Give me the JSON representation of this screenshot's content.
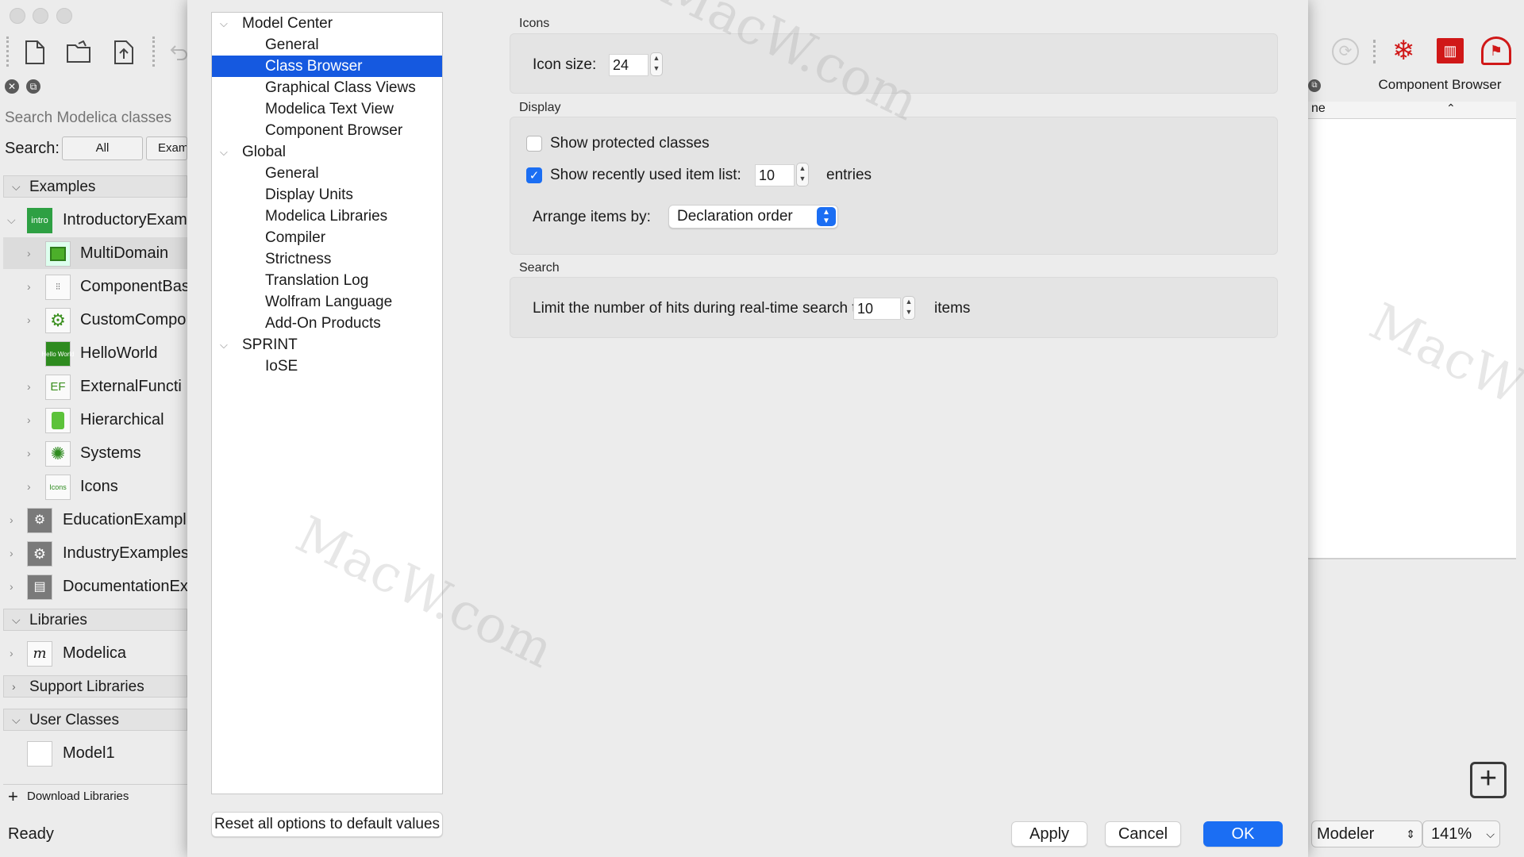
{
  "left_panel": {
    "search_placeholder": "Search Modelica classes",
    "search_label": "Search:",
    "search_scope": [
      "All",
      "Exam"
    ],
    "groups": {
      "examples": "Examples",
      "libraries": "Libraries",
      "support_libraries": "Support Libraries",
      "user_classes": "User Classes"
    },
    "tree": [
      {
        "label": "IntroductoryExam",
        "icon": "intro"
      },
      {
        "label": "MultiDomain"
      },
      {
        "label": "ComponentBas"
      },
      {
        "label": "CustomCompo"
      },
      {
        "label": "HelloWorld",
        "icon": "Hello World"
      },
      {
        "label": "ExternalFuncti",
        "icon": "EF"
      },
      {
        "label": "Hierarchical"
      },
      {
        "label": "Systems"
      },
      {
        "label": "Icons",
        "icon": "Icons"
      },
      {
        "label": "EducationExampl"
      },
      {
        "label": "IndustryExamples"
      },
      {
        "label": "DocumentationEx"
      },
      {
        "label": "Modelica"
      },
      {
        "label": "Model1"
      }
    ],
    "download_libraries": "Download Libraries",
    "status": "Ready"
  },
  "right_panel": {
    "title": "Component Browser",
    "column_header": "ne",
    "mode": "Modeler",
    "zoom": "141%"
  },
  "nav_tree": [
    {
      "label": "Model Center"
    },
    {
      "label": "General"
    },
    {
      "label": "Class Browser"
    },
    {
      "label": "Graphical Class Views"
    },
    {
      "label": "Modelica Text View"
    },
    {
      "label": "Component Browser"
    },
    {
      "label": "Global"
    },
    {
      "label": "General"
    },
    {
      "label": "Display Units"
    },
    {
      "label": "Modelica Libraries"
    },
    {
      "label": "Compiler"
    },
    {
      "label": "Strictness"
    },
    {
      "label": "Translation Log"
    },
    {
      "label": "Wolfram Language"
    },
    {
      "label": "Add-On Products"
    },
    {
      "label": "SPRINT"
    },
    {
      "label": "IoSE"
    }
  ],
  "reset_label": "Reset all options to default values",
  "icons_section": {
    "title": "Icons",
    "icon_size_label": "Icon size:",
    "icon_size_value": "24"
  },
  "display_section": {
    "title": "Display",
    "show_protected_label": "Show protected classes",
    "show_protected_checked": false,
    "show_recent_label": "Show recently used item list:",
    "show_recent_checked": true,
    "recent_count": "10",
    "entries_label": "entries",
    "arrange_label": "Arrange items by:",
    "arrange_value": "Declaration order"
  },
  "search_section": {
    "title": "Search",
    "limit_label": "Limit the number of hits during real-time search to:",
    "limit_value": "10",
    "items_label": "items"
  },
  "buttons": {
    "apply": "Apply",
    "cancel": "Cancel",
    "ok": "OK"
  },
  "watermark": "MacW.com",
  "colors": {
    "selection": "#1559e0",
    "accent": "#1b6ef3"
  }
}
